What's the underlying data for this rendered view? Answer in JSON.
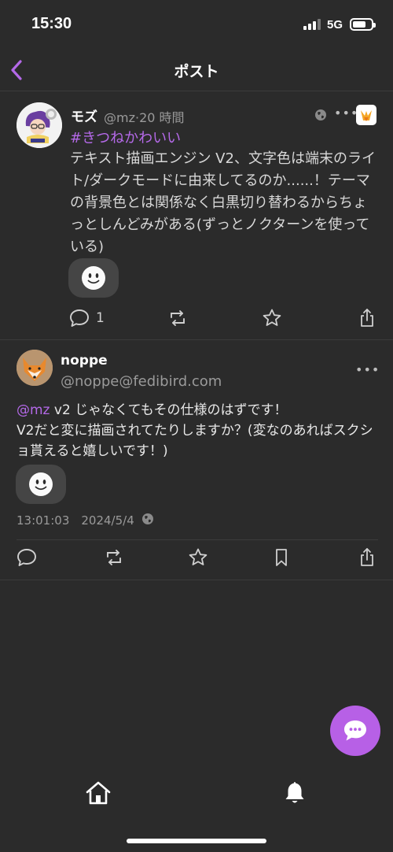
{
  "status_bar": {
    "time": "15:30",
    "network": "5G"
  },
  "nav": {
    "title": "ポスト"
  },
  "posts": [
    {
      "display_name": "モズ",
      "handle_time": "@mz·20 時間",
      "hashtag": "#きつねかわいい",
      "text": "テキスト描画エンジン V2、文字色は端末のライト/ダークモードに由来してるのか......！テーマの背景色とは関係なく白黒切り替わるからちょっとしんどみがある(ずっとノクターンを使っている)",
      "reply_count": "1"
    },
    {
      "display_name": "noppe",
      "handle": "@noppe@fedibird.com",
      "mention": "@mz",
      "text_line1": " v2 じゃなくてもその仕様のはずです！",
      "text_rest": "V2だと変に描画されてたりしますか？(変なのあればスクショ貰えると嬉しいです！)",
      "timestamp": "13:01:03　2024/5/4"
    }
  ],
  "icons": {
    "back": "chevron-left-icon",
    "globe": "globe-icon",
    "reply": "speech-bubble-icon",
    "boost": "repost-icon",
    "favorite": "star-icon",
    "bookmark": "bookmark-icon",
    "share": "share-icon",
    "reaction": "smiley-icon",
    "compose": "compose-bubble-icon",
    "home": "home-icon",
    "notifications": "bell-icon"
  },
  "colors": {
    "accent": "#b469e8",
    "fab": "#b760e6",
    "background": "#2b2b2b",
    "secondary_text": "#9a9a9a"
  }
}
